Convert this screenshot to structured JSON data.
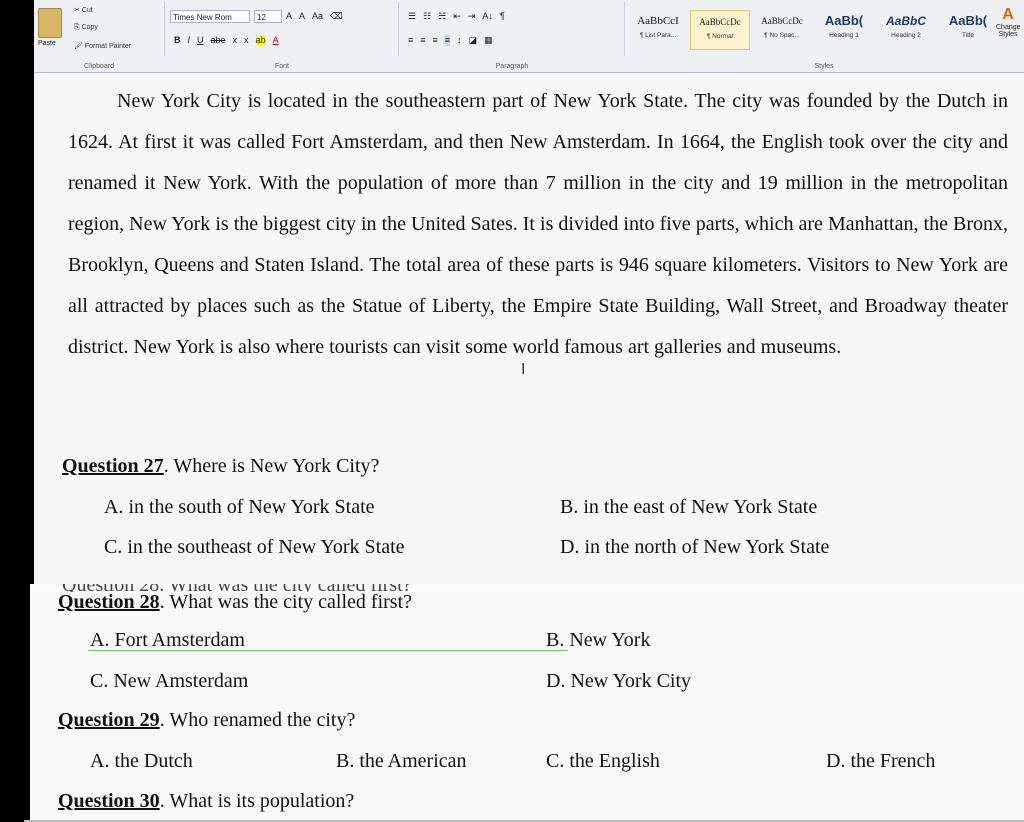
{
  "ribbon": {
    "clipboard": {
      "cut": "Cut",
      "copy": "Copy",
      "paste": "Paste",
      "format_painter": "Format Painter",
      "label": "Clipboard"
    },
    "font": {
      "name": "Times New Rom",
      "size": "12",
      "grow": "A",
      "shrink": "A",
      "case": "Aa",
      "bold": "B",
      "italic": "I",
      "underline": "U",
      "strike": "abe",
      "subscript": "x",
      "superscript": "x",
      "highlight": "ab",
      "font_color": "A",
      "label": "Font"
    },
    "paragraph": {
      "sort": "A↓",
      "pilcrow": "¶",
      "label": "Paragraph"
    },
    "styles": {
      "items": [
        {
          "preview": "AaBbCcI",
          "name": "¶ List Para..."
        },
        {
          "preview": "AaBbCcDc",
          "name": "¶ Normal"
        },
        {
          "preview": "AaBbCcDc",
          "name": "¶ No Spac..."
        },
        {
          "preview": "AaBb(",
          "name": "Heading 1"
        },
        {
          "preview": "AaBbC",
          "name": "Heading 2"
        },
        {
          "preview": "AaBb(",
          "name": "Title"
        }
      ],
      "label": "Styles",
      "change_styles": "Change Styles"
    }
  },
  "document": {
    "paragraph": "New York City is located in the southeastern part of New York State. The city was founded by the Dutch in 1624. At first it was called Fort Amsterdam, and then New Amsterdam. In 1664, the English took over the city and renamed it New York. With the population of more than 7 million in the city and 19 million in the metropolitan region, New York is the biggest city in the United Sates. It is divided into five parts, which are Manhattan, the Bronx, Brooklyn, Queens and Staten Island. The total area of these parts is 946 square kilometers. Visitors to New York are all attracted by places such as the Statue of Liberty, the Empire State Building, Wall Street, and Broadway theater district. New York is also where tourists can visit some world famous art galleries and museums.",
    "q27": {
      "num": "Question 27",
      "text": ". Where is New York City?",
      "a": "A. in the south of New York State",
      "b": "B. in the east of New York State",
      "c": "C. in the southeast of New York State",
      "d": "D. in the north of New York State"
    },
    "q28": {
      "num": "Question 28",
      "text": ".  What was the city called first?",
      "a": "A. Fort Amsterdam",
      "b": "B. New York",
      "c": "C. New Amsterdam",
      "d": "D. New York City"
    },
    "q29": {
      "num": "Question 29",
      "text": ". Who renamed the city?",
      "a": "A. the Dutch",
      "b": "B. the American",
      "c": "C. the English",
      "d": "D. the French"
    },
    "q30": {
      "num": "Question 30",
      "text": ". What is its population?"
    },
    "seam_text": "Question 28. What was the city called first?"
  }
}
